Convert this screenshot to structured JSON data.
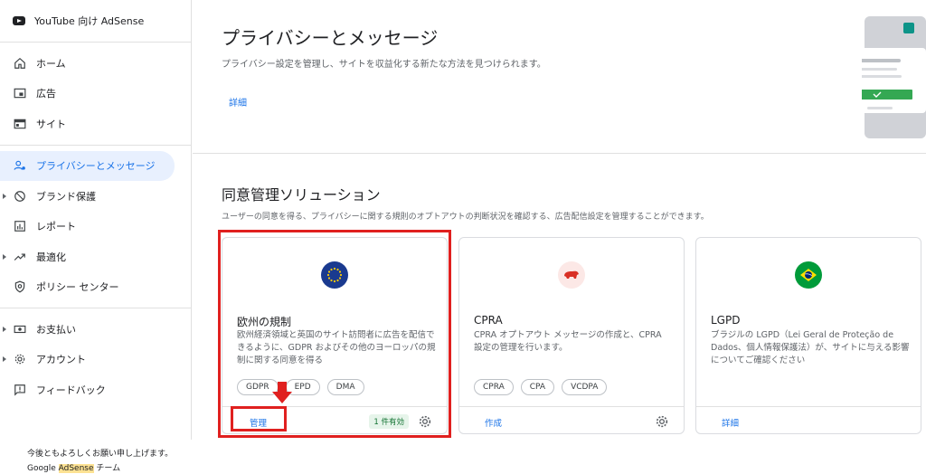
{
  "sidebar": {
    "brand": "YouTube 向け AdSense",
    "items": [
      {
        "label": "ホーム",
        "icon": "home-icon"
      },
      {
        "label": "広告",
        "icon": "ads-icon"
      },
      {
        "label": "サイト",
        "icon": "sites-icon"
      },
      {
        "label": "プライバシーとメッセージ",
        "icon": "privacy-icon",
        "active": true
      },
      {
        "label": "ブランド保護",
        "icon": "block-icon",
        "expandable": true
      },
      {
        "label": "レポート",
        "icon": "reports-icon"
      },
      {
        "label": "最適化",
        "icon": "trend-icon",
        "expandable": true
      },
      {
        "label": "ポリシー センター",
        "icon": "policy-icon"
      },
      {
        "label": "お支払い",
        "icon": "payments-icon",
        "expandable": true
      },
      {
        "label": "アカウント",
        "icon": "gear-icon",
        "expandable": true
      },
      {
        "label": "フィードバック",
        "icon": "feedback-icon"
      }
    ]
  },
  "hero": {
    "title": "プライバシーとメッセージ",
    "subtitle": "プライバシー設定を管理し、サイトを収益化する新たな方法を見つけられます。",
    "link": "詳細"
  },
  "section": {
    "title": "同意管理ソリューション",
    "subtitle": "ユーザーの同意を得る、プライバシーに関する規則のオプトアウトの判断状況を確認する、広告配信設定を管理することができます。"
  },
  "cards": [
    {
      "title": "欧州の規制",
      "description": "欧州経済領域と英国のサイト訪問者に広告を配信できるように、GDPR およびその他のヨーロッパの規制に関する同意を得る",
      "chips": [
        "GDPR",
        "EPD",
        "DMA"
      ],
      "action": "管理",
      "status": "1 件有効",
      "badge_color": "#1a3a8f"
    },
    {
      "title": "CPRA",
      "description": "CPRA オプトアウト メッセージの作成と、CPRA 設定の管理を行います。",
      "chips": [
        "CPRA",
        "CPA",
        "VCDPA"
      ],
      "action": "作成",
      "badge_color": "#fce8e6"
    },
    {
      "title": "LGPD",
      "description": "ブラジルの LGPD（Lei Geral de Proteção de Dados、個人情報保護法）が、サイトに与える影響についてご確認ください",
      "action": "詳細",
      "badge_color": "#009b3a"
    }
  ],
  "footer": {
    "line1": "今後ともよろしくお願い申し上げます。",
    "line2_pre": "Google ",
    "line2_hl": "AdSense",
    "line2_post": " チーム"
  },
  "colors": {
    "accent": "#1a73e8",
    "annotation": "#e0201f"
  }
}
